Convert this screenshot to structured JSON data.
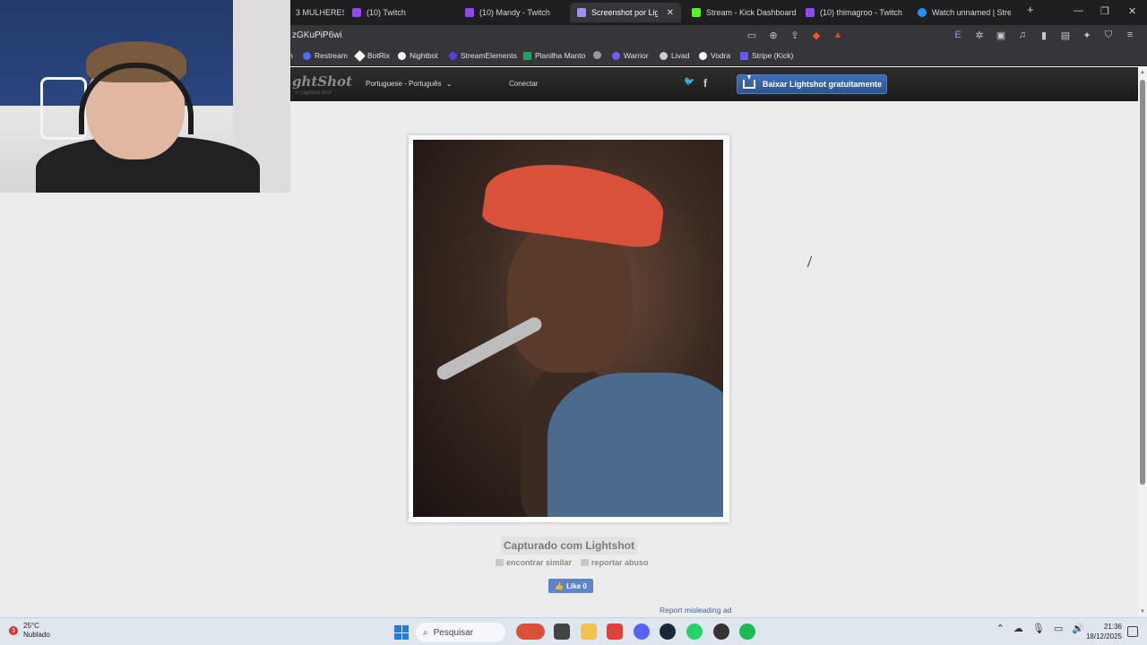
{
  "browser": {
    "tabs": [
      {
        "label": "3 MULHERES",
        "favicon_color": "#9146ff",
        "active": false
      },
      {
        "label": "(10) Twitch",
        "favicon_color": "#9146ff",
        "active": false
      },
      {
        "label": "(10) Mandy - Twitch",
        "favicon_color": "#9146ff",
        "active": false
      },
      {
        "label": "Screenshot por Lightsh",
        "favicon_color": "#a78bfa",
        "active": true
      },
      {
        "label": "Stream - Kick Dashboard",
        "favicon_color": "#53fc18",
        "active": false
      },
      {
        "label": "(10) thimagroo - Twitch",
        "favicon_color": "#9146ff",
        "active": false
      },
      {
        "label": "Watch unnamed | Streame",
        "favicon_color": "#1e90ff",
        "active": false
      }
    ],
    "new_tab_label": "+",
    "window_controls": [
      "—",
      "❐",
      "✕"
    ],
    "url": "zGKuPiP6wi",
    "bookmarks": [
      {
        "label": "Restream",
        "color": "#4a6cf7"
      },
      {
        "label": "BotRix",
        "color": "#ffffff"
      },
      {
        "label": "Nightbot",
        "color": "#ffffff"
      },
      {
        "label": "StreamElements",
        "color": "#5a3ee6"
      },
      {
        "label": "Planilha Manto",
        "color": "#1fa463"
      },
      {
        "label": "",
        "color": "#9a9a9a"
      },
      {
        "label": "Warrior",
        "color": "#7c5cff"
      },
      {
        "label": "Livad",
        "color": "#cccccc"
      },
      {
        "label": "Vodra",
        "color": "#ffffff"
      },
      {
        "label": "Stripe (Kick)",
        "color": "#635bff"
      }
    ],
    "bookmark_partial": "h"
  },
  "lightshot": {
    "logo": "ghtShot",
    "logo_sub": "n capture tool",
    "language": "Portuguese - Português",
    "language_arrow": "⌄",
    "login": "Conectar",
    "download_button": "Baixar Lightshot gratuitamente",
    "social": {
      "twitter": "🐦",
      "facebook": "f"
    },
    "captured_label": "Capturado com Lightshot",
    "find_similar": "encontrar similar",
    "report_abuse": "reportar abuso",
    "like_label": "Like 0",
    "report_ad": "Report misleading ad"
  },
  "taskbar": {
    "weather_badge": "3",
    "temperature": "25°C",
    "condition": "Nublado",
    "search_placeholder": "Pesquisar",
    "time": "21:36",
    "date": "18/12/2025",
    "apps": [
      "#d9513a",
      "#444",
      "#f2c14e",
      "#e2413b",
      "#5865f2",
      "#1b2838",
      "#25d366",
      "#d13438",
      "#1db954"
    ]
  }
}
